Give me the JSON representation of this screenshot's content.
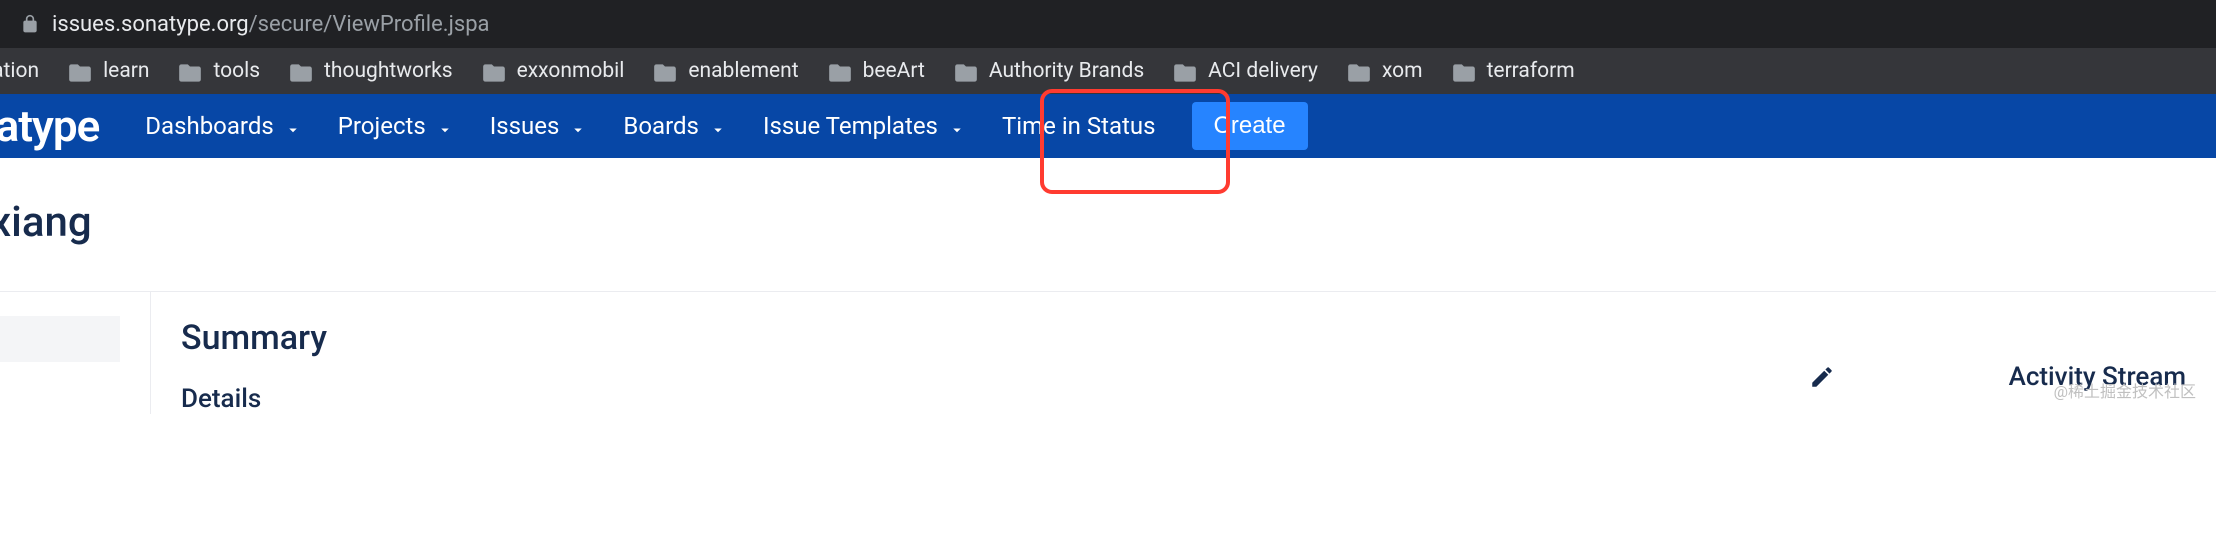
{
  "url": {
    "host": "issues.sonatype.org",
    "path": "/secure/ViewProfile.jspa"
  },
  "bookmarks": [
    "ciation",
    "learn",
    "tools",
    "thoughtworks",
    "exxonmobil",
    "enablement",
    "beeArt",
    "Authority Brands",
    "ACI delivery",
    "xom",
    "terraform"
  ],
  "logo": "natype",
  "nav": {
    "items": [
      "Dashboards",
      "Projects",
      "Issues",
      "Boards",
      "Issue Templates",
      "Time in Status"
    ],
    "dropdown": [
      true,
      true,
      true,
      true,
      true,
      false
    ],
    "create": "Create"
  },
  "page": {
    "title": "xiang",
    "summary": "Summary",
    "details": "Details",
    "activity": "Activity Stream"
  },
  "watermark": "@稀土掘金技术社区"
}
